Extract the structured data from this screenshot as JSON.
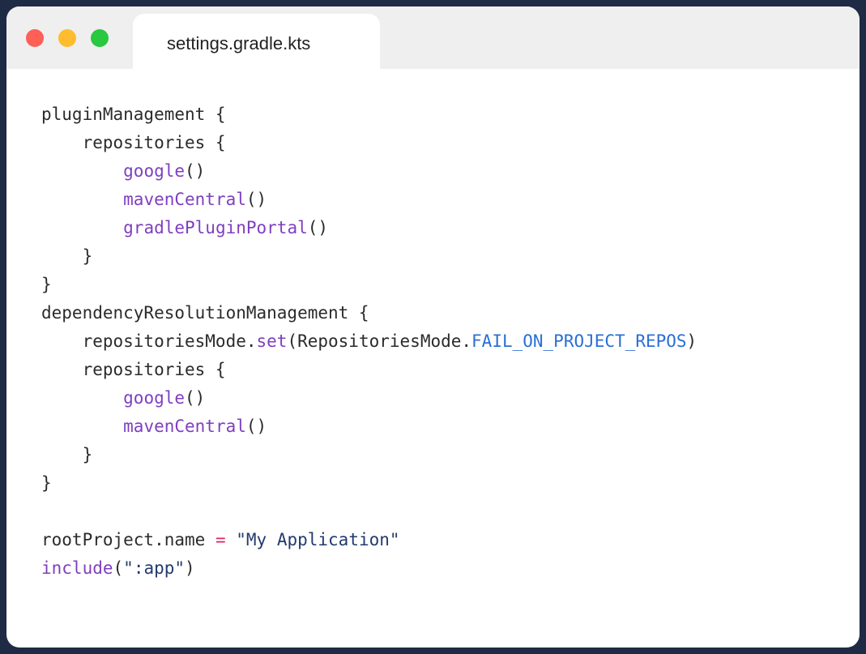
{
  "window": {
    "tab_title": "settings.gradle.kts",
    "traffic_lights": [
      {
        "name": "close",
        "color": "#fe5f57"
      },
      {
        "name": "minimize",
        "color": "#febc2e"
      },
      {
        "name": "maximize",
        "color": "#28c840"
      }
    ]
  },
  "colors": {
    "plain": "#2b2b2b",
    "function": "#7e3fbf",
    "constant": "#2b6fd4",
    "operator": "#e0245e",
    "string": "#223a6e"
  },
  "code": {
    "lines": [
      [
        {
          "t": "pluginManagement {",
          "k": "plain"
        }
      ],
      [
        {
          "t": "    repositories {",
          "k": "plain"
        }
      ],
      [
        {
          "t": "        ",
          "k": "plain"
        },
        {
          "t": "google",
          "k": "fn"
        },
        {
          "t": "()",
          "k": "plain"
        }
      ],
      [
        {
          "t": "        ",
          "k": "plain"
        },
        {
          "t": "mavenCentral",
          "k": "fn"
        },
        {
          "t": "()",
          "k": "plain"
        }
      ],
      [
        {
          "t": "        ",
          "k": "plain"
        },
        {
          "t": "gradlePluginPortal",
          "k": "fn"
        },
        {
          "t": "()",
          "k": "plain"
        }
      ],
      [
        {
          "t": "    }",
          "k": "plain"
        }
      ],
      [
        {
          "t": "}",
          "k": "plain"
        }
      ],
      [
        {
          "t": "dependencyResolutionManagement {",
          "k": "plain"
        }
      ],
      [
        {
          "t": "    repositoriesMode.",
          "k": "plain"
        },
        {
          "t": "set",
          "k": "fn"
        },
        {
          "t": "(RepositoriesMode.",
          "k": "plain"
        },
        {
          "t": "FAIL_ON_PROJECT_REPOS",
          "k": "const"
        },
        {
          "t": ")",
          "k": "plain"
        }
      ],
      [
        {
          "t": "    repositories {",
          "k": "plain"
        }
      ],
      [
        {
          "t": "        ",
          "k": "plain"
        },
        {
          "t": "google",
          "k": "fn"
        },
        {
          "t": "()",
          "k": "plain"
        }
      ],
      [
        {
          "t": "        ",
          "k": "plain"
        },
        {
          "t": "mavenCentral",
          "k": "fn"
        },
        {
          "t": "()",
          "k": "plain"
        }
      ],
      [
        {
          "t": "    }",
          "k": "plain"
        }
      ],
      [
        {
          "t": "}",
          "k": "plain"
        }
      ],
      [
        {
          "t": "",
          "k": "plain"
        }
      ],
      [
        {
          "t": "rootProject.name ",
          "k": "plain"
        },
        {
          "t": "=",
          "k": "op"
        },
        {
          "t": " ",
          "k": "plain"
        },
        {
          "t": "\"My Application\"",
          "k": "str"
        }
      ],
      [
        {
          "t": "include",
          "k": "fn"
        },
        {
          "t": "(",
          "k": "plain"
        },
        {
          "t": "\":app\"",
          "k": "str"
        },
        {
          "t": ")",
          "k": "plain"
        }
      ]
    ]
  }
}
